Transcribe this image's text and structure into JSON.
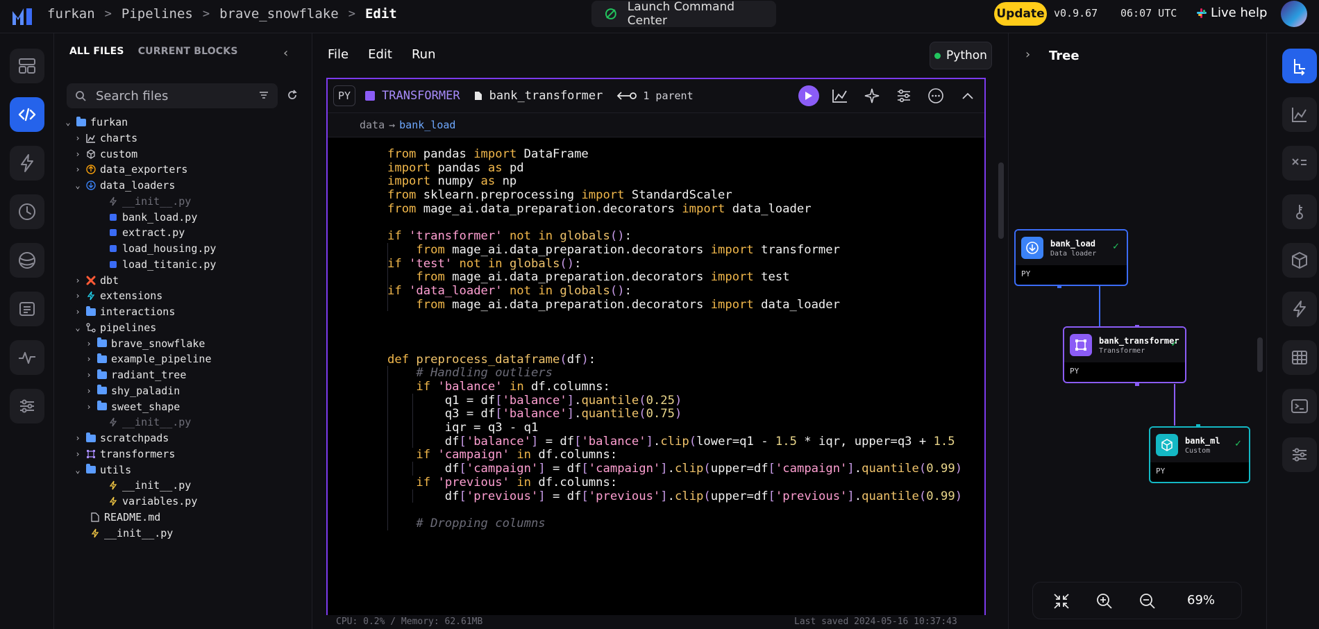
{
  "header": {
    "breadcrumbs": [
      "furkan",
      "Pipelines",
      "brave_snowflake"
    ],
    "current": "Edit",
    "launch_label": "Launch Command Center",
    "update_label": "Update",
    "version": "v0.9.67",
    "time": "06:07 UTC",
    "help_label": "Live help"
  },
  "files": {
    "tabs": [
      "ALL FILES",
      "CURRENT BLOCKS"
    ],
    "search_placeholder": "Search files",
    "items": [
      {
        "label": "furkan",
        "icon": "folder",
        "depth": 0,
        "chev": "v"
      },
      {
        "label": "charts",
        "icon": "chart",
        "depth": 1,
        "chev": ">"
      },
      {
        "label": "custom",
        "icon": "cube",
        "depth": 1,
        "chev": ">"
      },
      {
        "label": "data_exporters",
        "icon": "upload",
        "depth": 1,
        "chev": ">"
      },
      {
        "label": "data_loaders",
        "icon": "download",
        "depth": 1,
        "chev": "v"
      },
      {
        "label": "__init__.py",
        "icon": "bolt",
        "depth": 2,
        "chev": "",
        "dim": true
      },
      {
        "label": "bank_load.py",
        "icon": "py",
        "depth": 2,
        "chev": ""
      },
      {
        "label": "extract.py",
        "icon": "py",
        "depth": 2,
        "chev": ""
      },
      {
        "label": "load_housing.py",
        "icon": "py",
        "depth": 2,
        "chev": ""
      },
      {
        "label": "load_titanic.py",
        "icon": "py",
        "depth": 2,
        "chev": ""
      },
      {
        "label": "dbt",
        "icon": "dbt",
        "depth": 1,
        "chev": ">"
      },
      {
        "label": "extensions",
        "icon": "bolt-blue",
        "depth": 1,
        "chev": ">"
      },
      {
        "label": "interactions",
        "icon": "folder",
        "depth": 1,
        "chev": ">"
      },
      {
        "label": "pipelines",
        "icon": "pipeline",
        "depth": 1,
        "chev": "v"
      },
      {
        "label": "brave_snowflake",
        "icon": "folder",
        "depth": 2,
        "chev": ">"
      },
      {
        "label": "example_pipeline",
        "icon": "folder",
        "depth": 2,
        "chev": ">"
      },
      {
        "label": "radiant_tree",
        "icon": "folder",
        "depth": 2,
        "chev": ">"
      },
      {
        "label": "shy_paladin",
        "icon": "folder",
        "depth": 2,
        "chev": ">"
      },
      {
        "label": "sweet_shape",
        "icon": "folder",
        "depth": 2,
        "chev": ">"
      },
      {
        "label": "__init__.py",
        "icon": "bolt",
        "depth": 2,
        "chev": "",
        "dim": true
      },
      {
        "label": "scratchpads",
        "icon": "folder",
        "depth": 1,
        "chev": ">"
      },
      {
        "label": "transformers",
        "icon": "transform",
        "depth": 1,
        "chev": ">"
      },
      {
        "label": "utils",
        "icon": "folder",
        "depth": 1,
        "chev": "v"
      },
      {
        "label": "__init__.py",
        "icon": "bolt-yellow",
        "depth": 2,
        "chev": ""
      },
      {
        "label": "variables.py",
        "icon": "bolt-yellow",
        "depth": 2,
        "chev": ""
      },
      {
        "label": "README.md",
        "icon": "doc",
        "depth": 1,
        "chev": ""
      },
      {
        "label": "__init__.py",
        "icon": "bolt-yellow",
        "depth": 1,
        "chev": ""
      }
    ]
  },
  "editor": {
    "menu": [
      "File",
      "Edit",
      "Run"
    ],
    "language": "Python",
    "block": {
      "lang_tag": "PY",
      "type": "TRANSFORMER",
      "name": "bank_transformer",
      "parents": "1 parent",
      "upstream_prefix": "data",
      "upstream_link": "bank_load"
    },
    "code": [
      "from pandas import DataFrame",
      "import pandas as pd",
      "import numpy as np",
      "from sklearn.preprocessing import StandardScaler",
      "from mage_ai.data_preparation.decorators import data_loader",
      "",
      "if 'transformer' not in globals():",
      "    from mage_ai.data_preparation.decorators import transformer",
      "if 'test' not in globals():",
      "    from mage_ai.data_preparation.decorators import test",
      "if 'data_loader' not in globals():",
      "    from mage_ai.data_preparation.decorators import data_loader",
      "",
      "",
      "",
      "def preprocess_dataframe(df):",
      "    # Handling outliers",
      "    if 'balance' in df.columns:",
      "        q1 = df['balance'].quantile(0.25)",
      "        q3 = df['balance'].quantile(0.75)",
      "        iqr = q3 - q1",
      "        df['balance'] = df['balance'].clip(lower=q1 - 1.5 * iqr, upper=q3 + 1.5",
      "    if 'campaign' in df.columns:",
      "        df['campaign'] = df['campaign'].clip(upper=df['campaign'].quantile(0.99)",
      "    if 'previous' in df.columns:",
      "        df['previous'] = df['previous'].clip(upper=df['previous'].quantile(0.99)",
      "",
      "    # Dropping columns"
    ],
    "status_left": "CPU: 0.2%  /  Memory: 62.61MB",
    "status_right": "Last saved 2024-05-16 10:37:43"
  },
  "tree": {
    "title": "Tree",
    "zoom": "69%",
    "nodes": [
      {
        "name": "bank_load",
        "type": "Data loader",
        "lang": "PY",
        "color": "#3b82f6",
        "border": "#3b6cf6"
      },
      {
        "name": "bank_transformer",
        "type": "Transformer",
        "lang": "PY",
        "color": "#8b5cf6",
        "border": "#8b5cf6"
      },
      {
        "name": "bank_ml",
        "type": "Custom",
        "lang": "PY",
        "color": "#14b8c4",
        "border": "#14b8c4"
      }
    ]
  },
  "colors": {
    "accent": "#2563eb",
    "transformer": "#8b5cf6",
    "update": "#ffcc19",
    "success": "#22c55e"
  }
}
